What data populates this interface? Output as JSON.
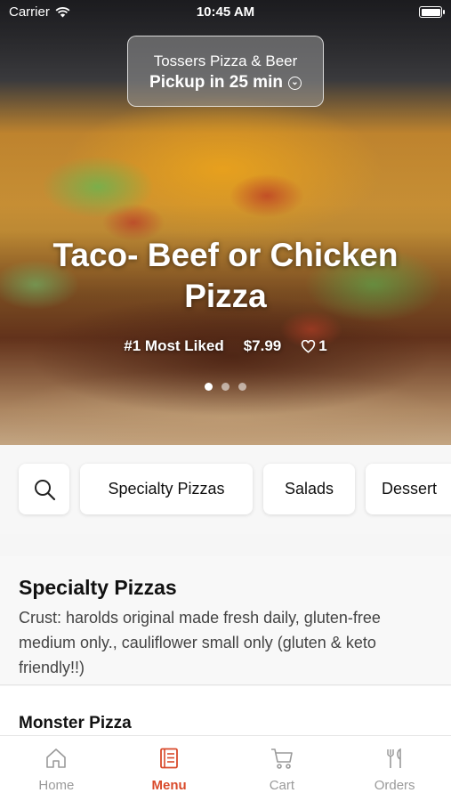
{
  "status_bar": {
    "carrier": "Carrier",
    "time": "10:45 AM"
  },
  "pickup": {
    "store_name": "Tossers Pizza & Beer",
    "pickup_time": "Pickup in 25 min"
  },
  "hero": {
    "title": "Taco- Beef or Chicken Pizza",
    "rank": "#1 Most Liked",
    "price": "$7.99",
    "likes": "1",
    "pages": 3,
    "active_page": 1
  },
  "categories": {
    "search_icon": "search-icon",
    "chips": [
      "Specialty Pizzas",
      "Salads",
      "Dessert"
    ]
  },
  "section": {
    "title": "Specialty Pizzas",
    "description": "Crust: harolds original made fresh daily, gluten-free medium only., cauliflower small only (gluten & keto friendly!!)"
  },
  "items": [
    {
      "name": "Monster Pizza"
    }
  ],
  "tab_bar": {
    "active_color": "#d94a2b",
    "inactive_color": "#9a9a9a",
    "tabs": [
      {
        "label": "Home",
        "icon": "home-icon"
      },
      {
        "label": "Menu",
        "icon": "menu-icon"
      },
      {
        "label": "Cart",
        "icon": "cart-icon"
      },
      {
        "label": "Orders",
        "icon": "orders-icon"
      }
    ],
    "active_tab": "Menu"
  }
}
